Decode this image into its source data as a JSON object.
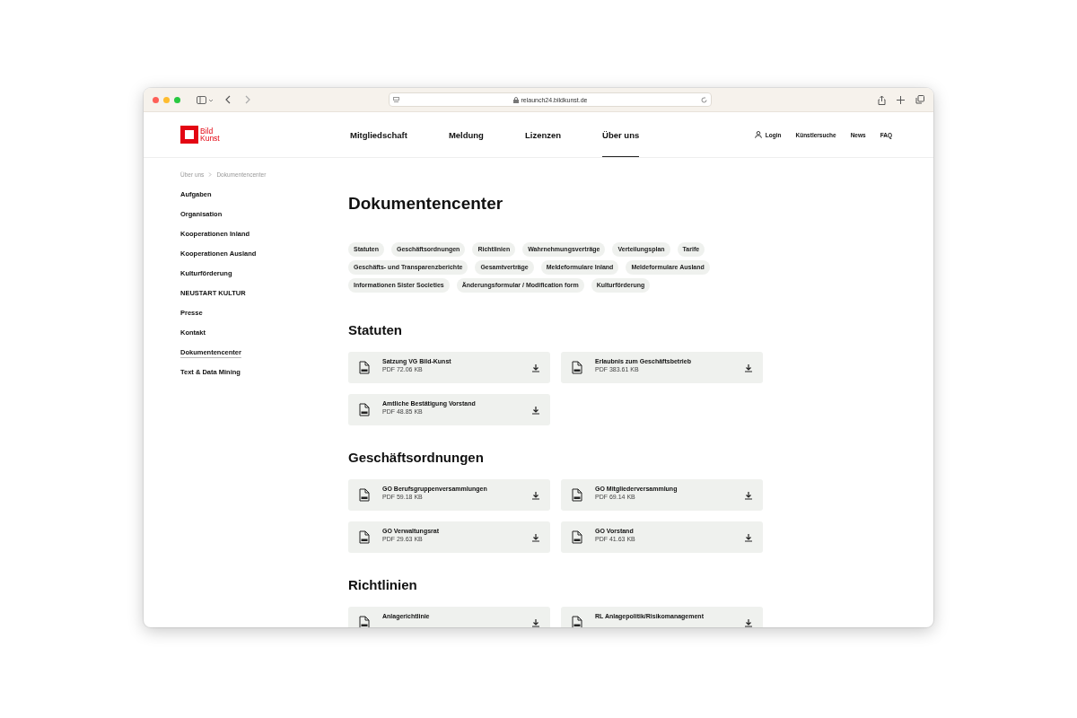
{
  "browser": {
    "url": "relaunch24.bildkunst.de"
  },
  "logo": {
    "line1": "Bild",
    "line2": "Kunst"
  },
  "nav": [
    {
      "label": "Mitgliedschaft",
      "selected": false
    },
    {
      "label": "Meldung",
      "selected": false
    },
    {
      "label": "Lizenzen",
      "selected": false
    },
    {
      "label": "Über uns",
      "selected": true
    }
  ],
  "utility_links": [
    {
      "label": "Login",
      "kind": "user"
    },
    {
      "label": "Künstlersuche",
      "kind": "text"
    },
    {
      "label": "News",
      "kind": "text"
    },
    {
      "label": "FAQ",
      "kind": "text"
    }
  ],
  "breadcrumb": [
    "Über uns",
    "Dokumentencenter"
  ],
  "sidebar": {
    "items": [
      {
        "label": "Aufgaben",
        "selected": false
      },
      {
        "label": "Organisation",
        "selected": false
      },
      {
        "label": "Kooperationen Inland",
        "selected": false
      },
      {
        "label": "Kooperationen Ausland",
        "selected": false
      },
      {
        "label": "Kulturförderung",
        "selected": false
      },
      {
        "label": "NEUSTART KULTUR",
        "selected": false
      },
      {
        "label": "Presse",
        "selected": false
      },
      {
        "label": "Kontakt",
        "selected": false
      },
      {
        "label": "Dokumentencenter",
        "selected": true
      },
      {
        "label": "Text & Data Mining",
        "selected": false
      }
    ]
  },
  "title": "Dokumentencenter",
  "filters": [
    [
      "Statuten",
      "Geschäftsordnungen",
      "Richtlinien",
      "Wahrnehmungsverträge",
      "Verteilungsplan",
      "Tarife"
    ],
    [
      "Geschäfts- und Transparenzberichte",
      "Gesamtverträge",
      "Meldeformulare Inland",
      "Meldeformulare Ausland"
    ],
    [
      "Informationen Sister Societies",
      "Änderungsformular / Modification form",
      "Kulturförderung"
    ]
  ],
  "sections": [
    {
      "heading": "Statuten",
      "documents": [
        {
          "title": "Satzung VG Bild-Kunst",
          "size": "PDF 72.06 KB"
        },
        {
          "title": "Erlaubnis zum Geschäftsbetrieb",
          "size": "PDF 383.61 KB"
        },
        {
          "title": "Amtliche Bestätigung Vorstand",
          "size": "PDF 48.85 KB"
        }
      ]
    },
    {
      "heading": "Geschäftsordnungen",
      "documents": [
        {
          "title": "GO Berufsgruppenversammlungen",
          "size": "PDF 59.18 KB"
        },
        {
          "title": "GO Mitgliederversammlung",
          "size": "PDF 69.14 KB"
        },
        {
          "title": "GO Verwaltungsrat",
          "size": "PDF 29.63 KB"
        },
        {
          "title": "GO Vorstand",
          "size": "PDF 41.63 KB"
        }
      ]
    },
    {
      "heading": "Richtlinien",
      "documents": [
        {
          "title": "Anlagerichtlinie"
        },
        {
          "title": "RL Anlagepolitik/Risikomanagement"
        }
      ]
    }
  ]
}
